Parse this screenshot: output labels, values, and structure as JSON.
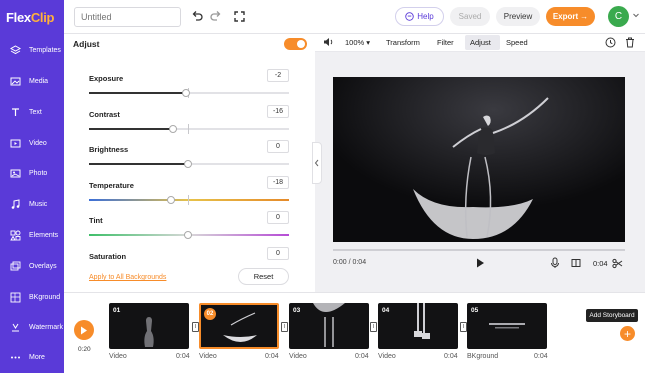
{
  "app": {
    "logo_flex": "Flex",
    "logo_clip": "Clip",
    "title_placeholder": "Untitled"
  },
  "header": {
    "help_label": "Help",
    "saved_label": "Saved",
    "preview_label": "Preview",
    "export_label": "Export",
    "avatar_letter": "C",
    "colors": {
      "brand": "#5a3ad8",
      "accent": "#f78c2a",
      "avatar": "#3aaa4e"
    }
  },
  "sidebar": {
    "items": [
      {
        "label": "Templates",
        "icon": "templates-icon"
      },
      {
        "label": "Media",
        "icon": "media-icon"
      },
      {
        "label": "Text",
        "icon": "text-icon"
      },
      {
        "label": "Video",
        "icon": "video-icon"
      },
      {
        "label": "Photo",
        "icon": "photo-icon"
      },
      {
        "label": "Music",
        "icon": "music-icon"
      },
      {
        "label": "Elements",
        "icon": "elements-icon"
      },
      {
        "label": "Overlays",
        "icon": "overlays-icon"
      },
      {
        "label": "BKground",
        "icon": "background-icon"
      },
      {
        "label": "Watermark",
        "icon": "watermark-icon"
      },
      {
        "label": "More",
        "icon": "more-icon"
      }
    ]
  },
  "adjust": {
    "title": "Adjust",
    "enabled": true,
    "rows": [
      {
        "label": "Exposure",
        "value": "-2"
      },
      {
        "label": "Contrast",
        "value": "-16"
      },
      {
        "label": "Brightness",
        "value": "0"
      },
      {
        "label": "Temperature",
        "value": "-18"
      },
      {
        "label": "Tint",
        "value": "0"
      },
      {
        "label": "Saturation",
        "value": "0"
      }
    ],
    "apply_all_label": "Apply to All Backgrounds",
    "reset_label": "Reset"
  },
  "toolbar": {
    "zoom": "100%",
    "items": [
      "Transform",
      "Filter",
      "Adjust",
      "Speed"
    ],
    "active": "Adjust"
  },
  "player": {
    "current_time": "0:00",
    "total_time": "0:04",
    "duration_right": "0:04"
  },
  "timeline": {
    "play_time": "0:20",
    "clips": [
      {
        "num": "01",
        "label": "Video",
        "duration": "0:04",
        "active": false
      },
      {
        "num": "02",
        "label": "Video",
        "duration": "0:04",
        "active": true
      },
      {
        "num": "03",
        "label": "Video",
        "duration": "0:04",
        "active": false
      },
      {
        "num": "04",
        "label": "Video",
        "duration": "0:04",
        "active": false
      },
      {
        "num": "05",
        "label": "BKground",
        "duration": "0:04",
        "active": false
      }
    ],
    "add_storyboard_label": "Add Storyboard"
  }
}
